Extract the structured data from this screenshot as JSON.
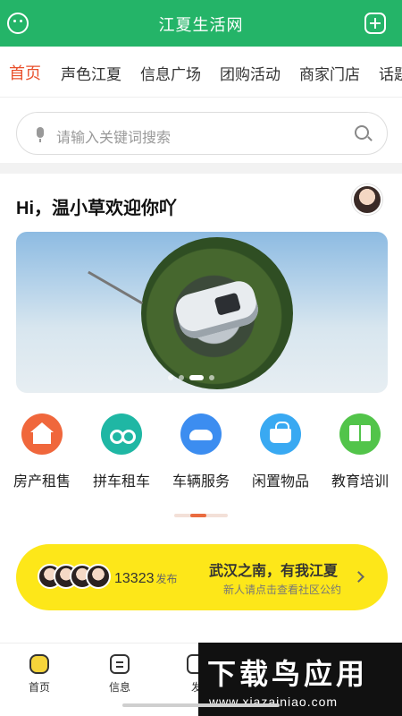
{
  "header": {
    "title": "江夏生活网",
    "left_icon": "smiley-icon",
    "right_icon": "add-icon"
  },
  "tabs": [
    {
      "label": "首页",
      "active": true
    },
    {
      "label": "声色江夏"
    },
    {
      "label": "信息广场"
    },
    {
      "label": "团购活动"
    },
    {
      "label": "商家门店"
    },
    {
      "label": "话题"
    }
  ],
  "search": {
    "placeholder": "请输入关键词搜索"
  },
  "greeting": "Hi，温小草欢迎你吖",
  "services": [
    {
      "label": "房产租售",
      "icon": "house-icon"
    },
    {
      "label": "拼车租车",
      "icon": "carpool-icon"
    },
    {
      "label": "车辆服务",
      "icon": "car-icon"
    },
    {
      "label": "闲置物品",
      "icon": "basket-icon"
    },
    {
      "label": "教育培训",
      "icon": "book-icon"
    }
  ],
  "promo": {
    "count": "13323",
    "count_suffix": "发布",
    "slogan": "武汉之南，有我江夏",
    "subtitle": "新人请点击查看社区公约"
  },
  "bottom_nav": [
    {
      "label": "首页",
      "icon": "home-icon"
    },
    {
      "label": "信息",
      "icon": "info-icon"
    },
    {
      "label": "发",
      "icon": "post-icon"
    }
  ],
  "watermark": {
    "title": "下载鸟应用",
    "url": "www.xiazainiao.com"
  },
  "colors": {
    "header": "#24b468",
    "active_tab": "#e9502c",
    "promo": "#fde719"
  }
}
